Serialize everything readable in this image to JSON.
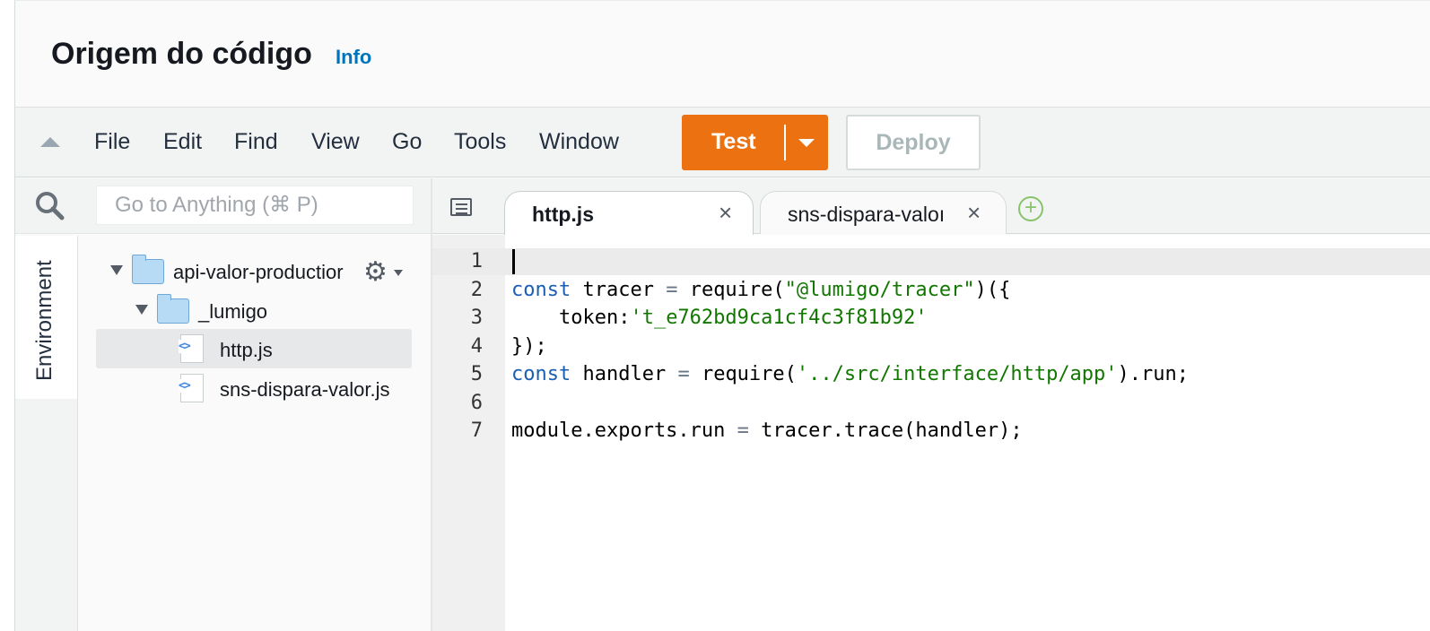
{
  "header": {
    "title": "Origem do código",
    "info_link": "Info"
  },
  "menubar": {
    "menus": [
      "File",
      "Edit",
      "Find",
      "View",
      "Go",
      "Tools",
      "Window"
    ],
    "test_label": "Test",
    "deploy_label": "Deploy"
  },
  "sidebar": {
    "search_placeholder": "Go to Anything (⌘ P)",
    "environment_tab": "Environment",
    "tree": {
      "root": "api-valor-productior",
      "folder": "_lumigo",
      "files": [
        "http.js",
        "sns-dispara-valor.js"
      ],
      "selected": "http.js"
    }
  },
  "editor": {
    "tabs": [
      {
        "label": "http.js",
        "active": true
      },
      {
        "label": "sns-dispara-valoı",
        "active": false
      }
    ],
    "line_numbers": [
      "1",
      "2",
      "3",
      "4",
      "5",
      "6",
      "7"
    ],
    "code": {
      "l2": {
        "kw": "const",
        "a": " tracer ",
        "op": "=",
        "b": " require(",
        "str": "\"@lumigo/tracer\"",
        "c": ")({"
      },
      "l3": {
        "a": "    token:",
        "str": "'t_e762bd9ca1cf4c3f81b92'"
      },
      "l4": {
        "a": "});"
      },
      "l5": {
        "kw": "const",
        "a": " handler ",
        "op": "=",
        "b": " require(",
        "str": "'../src/interface/http/app'",
        "c": ").run;"
      },
      "l7": {
        "a": "module.exports.run ",
        "op": "=",
        "b": " tracer.trace(handler);"
      }
    }
  },
  "icons": {
    "collapse": "triangle-up-icon",
    "search": "search-icon",
    "gear": "gear-icon",
    "tabs_menu": "tabs-menu-icon",
    "close": "close-icon",
    "add": "add-tab-icon"
  },
  "colors": {
    "test_button": "#ec7211",
    "info_link": "#0073bb",
    "keyword": "#1a5fb4",
    "string": "#117700"
  }
}
